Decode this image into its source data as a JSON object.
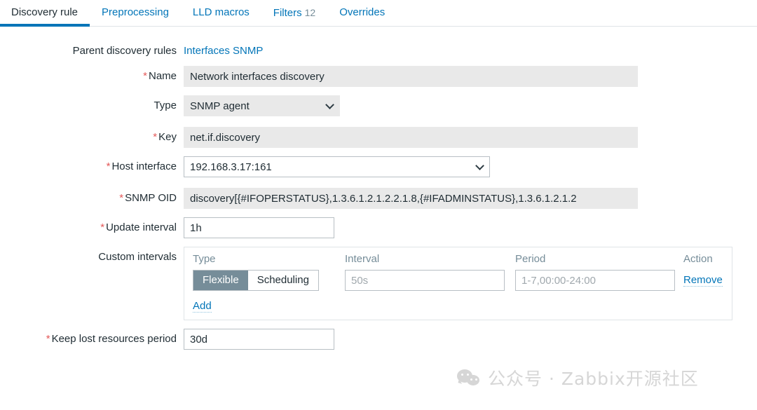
{
  "tabs": [
    {
      "label": "Discovery rule",
      "active": true,
      "count": ""
    },
    {
      "label": "Preprocessing",
      "active": false,
      "count": ""
    },
    {
      "label": "LLD macros",
      "active": false,
      "count": ""
    },
    {
      "label": "Filters",
      "active": false,
      "count": "12"
    },
    {
      "label": "Overrides",
      "active": false,
      "count": ""
    }
  ],
  "form": {
    "parent_discovery_rules": {
      "label": "Parent discovery rules",
      "link_text": "Interfaces SNMP"
    },
    "name": {
      "label": "Name",
      "required": true,
      "value": "Network interfaces discovery"
    },
    "type": {
      "label": "Type",
      "required": false,
      "value": "SNMP agent"
    },
    "key": {
      "label": "Key",
      "required": true,
      "value": "net.if.discovery"
    },
    "host_interface": {
      "label": "Host interface",
      "required": true,
      "value": "192.168.3.17:161"
    },
    "snmp_oid": {
      "label": "SNMP OID",
      "required": true,
      "value": "discovery[{#IFOPERSTATUS},1.3.6.1.2.1.2.2.1.8,{#IFADMINSTATUS},1.3.6.1.2.1.2"
    },
    "update_interval": {
      "label": "Update interval",
      "required": true,
      "value": "1h"
    },
    "custom_intervals": {
      "label": "Custom intervals",
      "required": false,
      "headers": [
        "Type",
        "Interval",
        "Period",
        "Action"
      ],
      "rows": [
        {
          "type_options": [
            "Flexible",
            "Scheduling"
          ],
          "type_selected": "Flexible",
          "interval_value": "",
          "interval_placeholder": "50s",
          "period_value": "",
          "period_placeholder": "1-7,00:00-24:00",
          "action_label": "Remove"
        }
      ],
      "add_label": "Add"
    },
    "keep_lost_resources_period": {
      "label": "Keep lost resources period",
      "required": true,
      "value": "30d"
    }
  },
  "watermark": {
    "text": "公众号 · Zabbix开源社区",
    "icon": "wechat-icon"
  },
  "colors": {
    "accent": "#0275b8",
    "required": "#e45959",
    "toggle_active": "#768d99",
    "readonly_bg": "#e9e9e9",
    "border": "#b8bfc4"
  }
}
